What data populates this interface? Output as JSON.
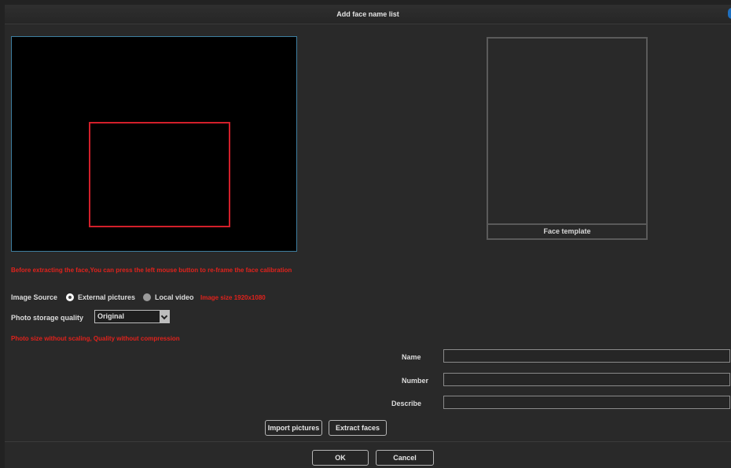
{
  "window": {
    "title": "Add face name list"
  },
  "face_template": {
    "label": "Face template"
  },
  "hint_reframe": "Before extracting the face,You can press the left mouse button to re-frame the face calibration",
  "image_source": {
    "label": "Image Source",
    "options": [
      {
        "label": "External pictures",
        "selected": true
      },
      {
        "label": "Local video",
        "selected": false
      }
    ],
    "size_note": "Image size 1920x1080"
  },
  "photo_quality": {
    "label": "Photo storage quality",
    "value": "Original",
    "note": "Photo size without scaling, Quality without compression"
  },
  "form": {
    "name_label": "Name",
    "number_label": "Number",
    "describe_label": "Describe",
    "name_value": "",
    "number_value": "",
    "describe_value": ""
  },
  "buttons": {
    "import": "Import pictures",
    "extract": "Extract faces",
    "ok": "OK",
    "cancel": "Cancel"
  },
  "colors": {
    "warning": "#e0221c",
    "preview_border": "#3e7fa0",
    "calibration_frame": "#d21f2a"
  }
}
